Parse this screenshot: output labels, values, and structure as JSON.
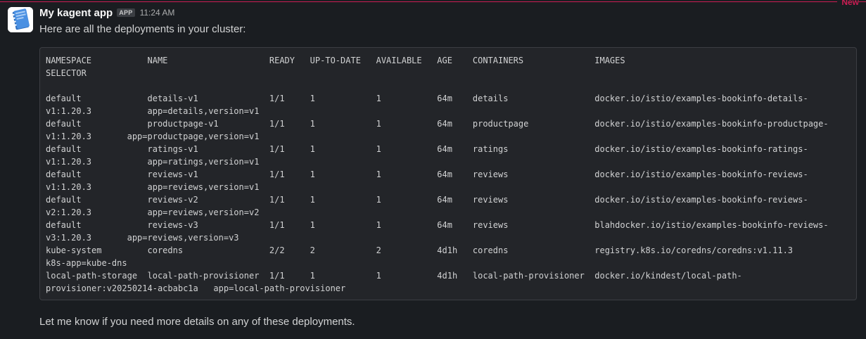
{
  "divider": {
    "label": "New"
  },
  "message": {
    "sender": "My kagent app",
    "badge": "APP",
    "timestamp": "11:24 AM",
    "intro": "Here are all the deployments in your cluster:",
    "code_lines": [
      "NAMESPACE           NAME                    READY   UP-TO-DATE   AVAILABLE   AGE    CONTAINERS              IMAGES",
      "SELECTOR",
      "",
      "default             details-v1              1/1     1            1           64m    details                 docker.io/istio/examples-bookinfo-details-",
      "v1:1.20.3           app=details,version=v1",
      "default             productpage-v1          1/1     1            1           64m    productpage             docker.io/istio/examples-bookinfo-productpage-",
      "v1:1.20.3       app=productpage,version=v1",
      "default             ratings-v1              1/1     1            1           64m    ratings                 docker.io/istio/examples-bookinfo-ratings-",
      "v1:1.20.3           app=ratings,version=v1",
      "default             reviews-v1              1/1     1            1           64m    reviews                 docker.io/istio/examples-bookinfo-reviews-",
      "v1:1.20.3           app=reviews,version=v1",
      "default             reviews-v2              1/1     1            1           64m    reviews                 docker.io/istio/examples-bookinfo-reviews-",
      "v2:1.20.3           app=reviews,version=v2",
      "default             reviews-v3              1/1     1            1           64m    reviews                 blahdocker.io/istio/examples-bookinfo-reviews-",
      "v3:1.20.3       app=reviews,version=v3",
      "kube-system         coredns                 2/2     2            2           4d1h   coredns                 registry.k8s.io/coredns/coredns:v1.11.3",
      "k8s-app=kube-dns",
      "local-path-storage  local-path-provisioner  1/1     1            1           4d1h   local-path-provisioner  docker.io/kindest/local-path-",
      "provisioner:v20250214-acbabc1a   app=local-path-provisioner"
    ],
    "outro": "Let me know if you need more details on any of these deployments."
  },
  "avatar": {
    "icon": "notebook-icon",
    "colors": {
      "cover": "#4a90e2",
      "spine": "#2f6fbf",
      "page": "#ffffff"
    }
  }
}
